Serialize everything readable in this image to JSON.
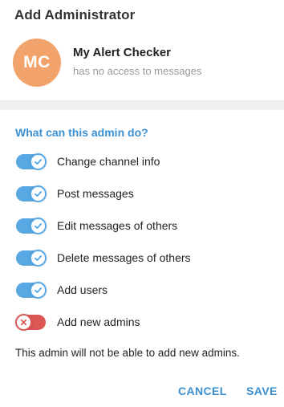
{
  "dialog": {
    "title": "Add Administrator"
  },
  "user": {
    "initials": "MC",
    "name": "My Alert Checker",
    "status": "has no access to messages",
    "avatar_color": "#f2a36b"
  },
  "permissions": {
    "section_title": "What can this admin do?",
    "items": [
      {
        "label": "Change channel info",
        "enabled": true
      },
      {
        "label": "Post messages",
        "enabled": true
      },
      {
        "label": "Edit messages of others",
        "enabled": true
      },
      {
        "label": "Delete messages of others",
        "enabled": true
      },
      {
        "label": "Add users",
        "enabled": true
      },
      {
        "label": "Add new admins",
        "enabled": false
      }
    ],
    "note": "This admin will not be able to add new admins."
  },
  "buttons": {
    "cancel": "CANCEL",
    "save": "SAVE"
  },
  "colors": {
    "accent": "#3a8fd1",
    "toggle_on": "#57a8e3",
    "toggle_off": "#dd5757"
  }
}
